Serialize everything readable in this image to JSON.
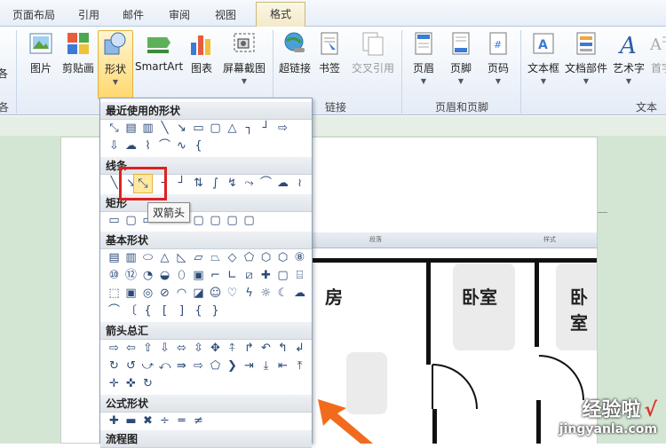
{
  "tabs": [
    "页面布局",
    "引用",
    "邮件",
    "审阅",
    "视图",
    "格式"
  ],
  "ribbon": {
    "buttons": [
      "图片",
      "剪贴画",
      "形状",
      "SmartArt",
      "图表",
      "屏幕截图",
      "超链接",
      "书签",
      "交叉引用",
      "页眉",
      "页脚",
      "页码",
      "文本框",
      "文档部件",
      "艺术字",
      "首字"
    ],
    "groups": [
      "链接",
      "页眉和页脚",
      "文本"
    ],
    "left_partial": [
      "各",
      "各"
    ]
  },
  "dropdown": {
    "sections": [
      "最近使用的形状",
      "线条",
      "矩形",
      "基本形状",
      "箭头总汇",
      "公式形状",
      "流程图"
    ]
  },
  "tooltip": "双箭头",
  "inner_ruler": [
    "段落",
    "样式"
  ],
  "rooms": [
    "房",
    "卧室",
    "卧室"
  ],
  "watermark": {
    "main": "经验啦",
    "check": "√",
    "url": "jingyanla.com"
  }
}
